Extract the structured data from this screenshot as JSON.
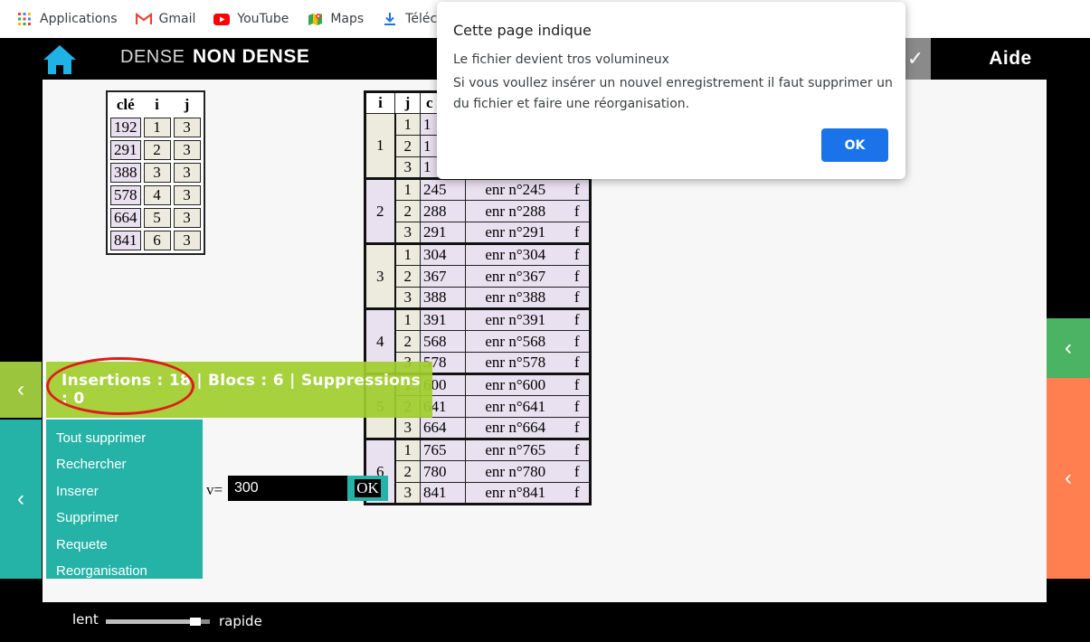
{
  "bookmarks": [
    {
      "label": "Applications",
      "icon": "apps-grid-icon"
    },
    {
      "label": "Gmail",
      "icon": "gmail-icon"
    },
    {
      "label": "YouTube",
      "icon": "youtube-icon"
    },
    {
      "label": "Maps",
      "icon": "maps-icon"
    },
    {
      "label": "Télécharg",
      "icon": "download-icon"
    }
  ],
  "header": {
    "mode_dense": "DENSE",
    "mode_nondense": "NON DENSE",
    "check_glyph": "✓",
    "help": "Aide"
  },
  "index_table": {
    "headers": [
      "clé",
      "i",
      "j"
    ],
    "rows": [
      [
        "192",
        "1",
        "3"
      ],
      [
        "291",
        "2",
        "3"
      ],
      [
        "388",
        "3",
        "3"
      ],
      [
        "578",
        "4",
        "3"
      ],
      [
        "664",
        "5",
        "3"
      ],
      [
        "841",
        "6",
        "3"
      ]
    ]
  },
  "main_table": {
    "headers": [
      "i",
      "j",
      "c"
    ],
    "blocks": [
      {
        "i": "1",
        "rows": [
          [
            "1",
            "1",
            "",
            ""
          ],
          [
            "2",
            "1",
            "",
            ""
          ],
          [
            "3",
            "1",
            "",
            ""
          ]
        ]
      },
      {
        "i": "2",
        "rows": [
          [
            "1",
            "245",
            "enr n°245",
            "f"
          ],
          [
            "2",
            "288",
            "enr n°288",
            "f"
          ],
          [
            "3",
            "291",
            "enr n°291",
            "f"
          ]
        ]
      },
      {
        "i": "3",
        "rows": [
          [
            "1",
            "304",
            "enr n°304",
            "f"
          ],
          [
            "2",
            "367",
            "enr n°367",
            "f"
          ],
          [
            "3",
            "388",
            "enr n°388",
            "f"
          ]
        ]
      },
      {
        "i": "4",
        "rows": [
          [
            "1",
            "391",
            "enr n°391",
            "f"
          ],
          [
            "2",
            "568",
            "enr n°568",
            "f"
          ],
          [
            "3",
            "578",
            "enr n°578",
            "f"
          ]
        ]
      },
      {
        "i": "5",
        "rows": [
          [
            "1",
            "600",
            "enr n°600",
            "f"
          ],
          [
            "2",
            "641",
            "enr n°641",
            "f"
          ],
          [
            "3",
            "664",
            "enr n°664",
            "f"
          ]
        ]
      },
      {
        "i": "6",
        "rows": [
          [
            "1",
            "765",
            "enr n°765",
            "f"
          ],
          [
            "2",
            "780",
            "enr n°780",
            "f"
          ],
          [
            "3",
            "841",
            "enr n°841",
            "f"
          ]
        ]
      }
    ]
  },
  "stats": {
    "text": "Insertions : 18 | Blocs : 6 | Suppressions : 0"
  },
  "menu": {
    "items": [
      "Tout supprimer",
      "Rechercher",
      "Inserer",
      "Supprimer",
      "Requete",
      "Reorganisation"
    ]
  },
  "value_form": {
    "label": "v=",
    "value": "300",
    "ok": "OK"
  },
  "speed": {
    "slow": "lent",
    "fast": "rapide",
    "level": 0.9
  },
  "dialog": {
    "title": "Cette page indique",
    "line1": "Le fichier devient tros volumineux",
    "line2": "Si vous voullez insérer un nouvel enregistrement il faut supprimer un du fichier et faire une réorganisation.",
    "ok": "OK"
  },
  "colors": {
    "stats_bar": "#a0cd2d",
    "menu": "#25b3a7",
    "right_green": "#4bb364",
    "right_orange": "#ff7f50",
    "dialog_button": "#1a73e8",
    "highlight_ellipse": "#e01b1b"
  }
}
